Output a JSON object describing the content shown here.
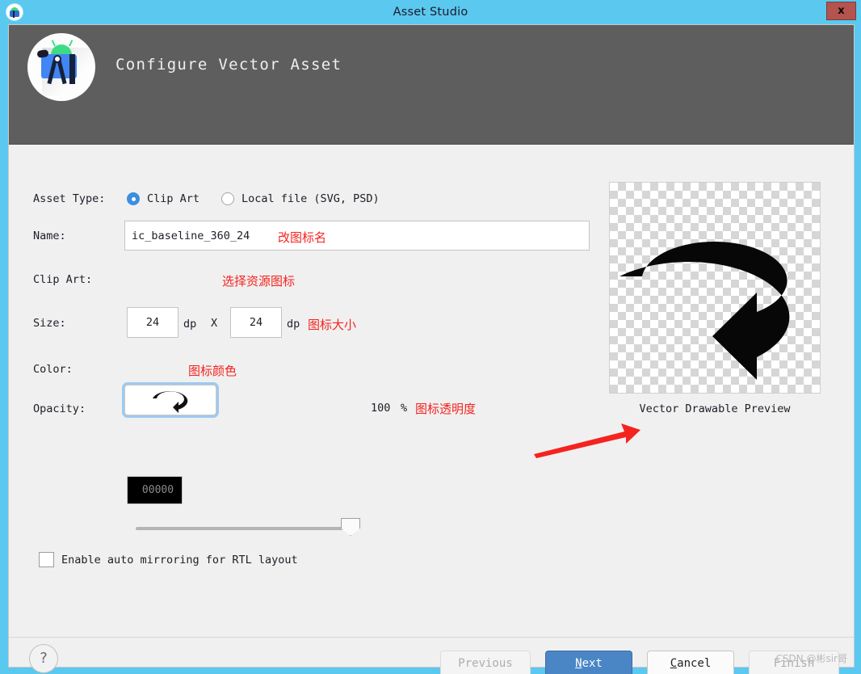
{
  "window": {
    "title": "Asset Studio",
    "app_icon": "android-studio-icon",
    "close_label": "x"
  },
  "header": {
    "title": "Configure Vector Asset",
    "logo": "android-studio-logo"
  },
  "form": {
    "asset_type": {
      "label": "Asset Type:",
      "options": [
        {
          "label": "Clip Art",
          "selected": true
        },
        {
          "label": "Local file (SVG, PSD)",
          "selected": false
        }
      ]
    },
    "name": {
      "label": "Name:",
      "value": "ic_baseline_360_24",
      "placeholder": "ic_baseline_360_24",
      "annotation": "改图标名"
    },
    "clip_art": {
      "label": "Clip Art:",
      "icon": "rotate-360-icon",
      "annotation": "选择资源图标"
    },
    "size": {
      "label": "Size:",
      "width": "24",
      "height": "24",
      "unit": "dp",
      "separator": "X",
      "annotation": "图标大小"
    },
    "color": {
      "label": "Color:",
      "value": "00000",
      "swatch_hex": "#000000",
      "annotation": "图标颜色"
    },
    "opacity": {
      "label": "Opacity:",
      "value": "100",
      "unit": "%",
      "annotation": "图标透明度"
    },
    "mirroring": {
      "label": "Enable auto mirroring for RTL layout",
      "checked": false
    }
  },
  "preview": {
    "caption": "Vector Drawable Preview",
    "icon": "rotate-360-icon"
  },
  "footer": {
    "help_label": "?",
    "buttons": [
      {
        "name": "previous",
        "label": "Previous",
        "disabled": true
      },
      {
        "name": "next",
        "label": "Next",
        "mnemonic": "N",
        "rest": "ext",
        "primary": true
      },
      {
        "name": "cancel",
        "label": "Cancel",
        "mnemonic": "C",
        "rest": "ancel"
      },
      {
        "name": "finish",
        "label": "Finish",
        "disabled": true
      }
    ],
    "watermark": "CSDN @彬sir哥"
  },
  "colors": {
    "titlebar": "#5bc8ef",
    "header": "#5e5e5e",
    "body": "#f0f0f0",
    "accent": "#4a86c5",
    "annotation": "#f5231f",
    "close": "#b3544f"
  }
}
